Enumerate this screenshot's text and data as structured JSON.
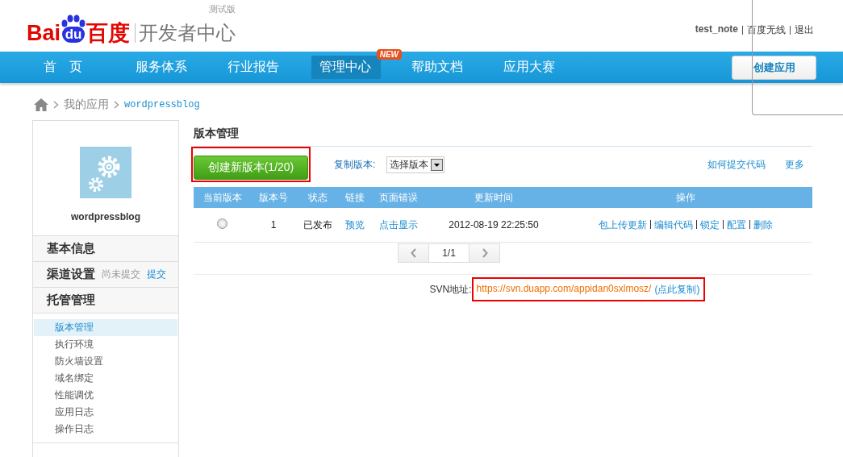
{
  "header": {
    "logo_latin": "Bai",
    "logo_du": "du",
    "logo_cn": "百度",
    "product": "开发者中心",
    "badge": "测试版",
    "user": "test_note",
    "links": [
      "百度无线",
      "退出"
    ]
  },
  "nav": {
    "items": [
      {
        "label": "首　页",
        "selected": false
      },
      {
        "label": "服务体系",
        "selected": false
      },
      {
        "label": "行业报告",
        "selected": false
      },
      {
        "label": "管理中心",
        "selected": true,
        "badge": "NEW"
      },
      {
        "label": "帮助文档",
        "selected": false
      },
      {
        "label": "应用大赛",
        "selected": false
      }
    ],
    "create_button": "创建应用"
  },
  "breadcrumb": {
    "items": [
      "我的应用"
    ],
    "current": "wordpressblog"
  },
  "sidebar": {
    "app_name": "wordpressblog",
    "sections": [
      {
        "title": "基本信息"
      },
      {
        "title": "渠道设置",
        "note": "尚未提交",
        "link": "提交"
      },
      {
        "title": "托管管理",
        "children": [
          {
            "label": "版本管理",
            "selected": true
          },
          {
            "label": "执行环境",
            "selected": false
          },
          {
            "label": "防火墙设置",
            "selected": false
          },
          {
            "label": "域名绑定",
            "selected": false
          },
          {
            "label": "性能调优",
            "selected": false
          },
          {
            "label": "应用日志",
            "selected": false
          },
          {
            "label": "操作日志",
            "selected": false
          }
        ]
      }
    ]
  },
  "main": {
    "title": "版本管理",
    "create_button": "创建新版本(1/20)",
    "copy_label": "复制版本:",
    "copy_select": "选择版本",
    "links": [
      "如何提交代码",
      "更多"
    ],
    "table": {
      "columns": [
        "当前版本",
        "版本号",
        "状态",
        "链接",
        "页面错误",
        "更新时间",
        "操作"
      ],
      "rows": [
        {
          "selected": false,
          "version": "1",
          "status": "已发布",
          "link": "预览",
          "error": "点击显示",
          "time": "2012-08-19 22:25:50",
          "actions": [
            "包上传更新",
            "编辑代码",
            "锁定",
            "配置",
            "删除"
          ]
        }
      ]
    },
    "pagination": {
      "page": "1/1"
    },
    "svn": {
      "label": "SVN地址:",
      "url": "https://svn.duapp.com/appidan0sxlmosz/",
      "copy": "(点此复制)"
    }
  }
}
